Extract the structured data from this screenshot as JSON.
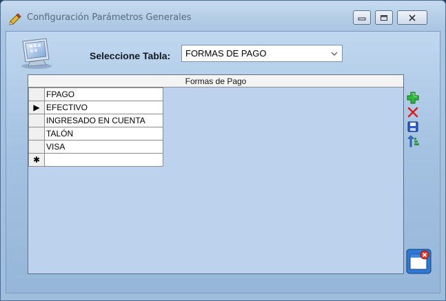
{
  "window": {
    "title": "Configuración Parámetros Generales"
  },
  "selector": {
    "label": "Seleccione Tabla:",
    "value": "FORMAS DE PAGO"
  },
  "grid": {
    "caption": "Formas de Pago",
    "column_header": "FPAGO",
    "rows": [
      "EFECTIVO",
      "INGRESADO EN CUENTA",
      "TALÓN",
      "VISA"
    ],
    "current_row_marker": "▶",
    "new_row_marker": "✱"
  },
  "colors": {
    "accent_add": "#1aa02a",
    "accent_delete": "#d42020",
    "accent_save": "#2a5bd0"
  },
  "icons": [
    "app-config-icon",
    "add-icon",
    "delete-icon",
    "save-icon",
    "sort-icon",
    "close-window-icon"
  ]
}
